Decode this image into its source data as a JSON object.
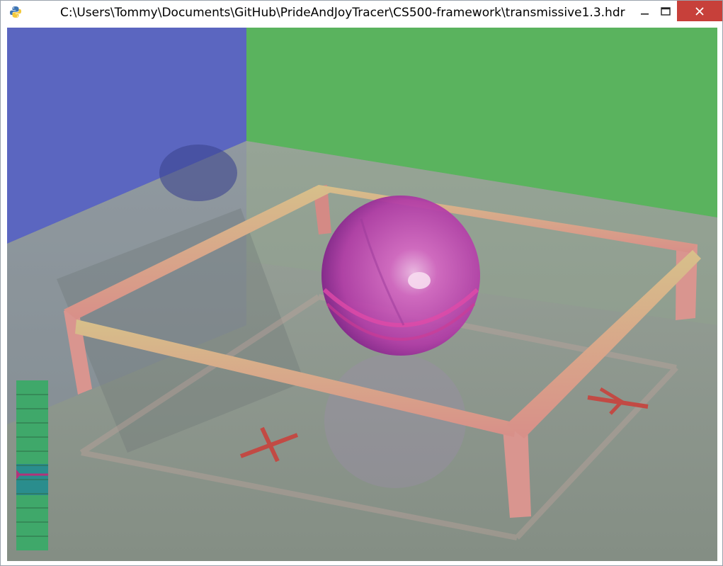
{
  "window": {
    "title": "C:\\Users\\Tommy\\Documents\\GitHub\\PrideAndJoyTracer\\CS500-framework\\transmissive1.3.hdr",
    "app_icon": "python-icon",
    "controls": {
      "minimize_icon": "minimize-icon",
      "maximize_icon": "maximize-icon",
      "close_icon": "close-icon"
    }
  },
  "scene": {
    "axis_labels": {
      "x": "X",
      "y": "Y"
    },
    "colors": {
      "left_wall": "#5b66c0",
      "back_wall": "#5ab35e",
      "floor": "#8a9488",
      "sphere": "#c850b4",
      "frame": "#d9958f",
      "axis_marker": "#c24a44"
    }
  },
  "legend": {
    "segments": 12,
    "marker_fraction": 0.55,
    "colors": {
      "base": "#3fa86a",
      "highlight": "#2a8d8d",
      "marker": "#b3327a"
    }
  }
}
